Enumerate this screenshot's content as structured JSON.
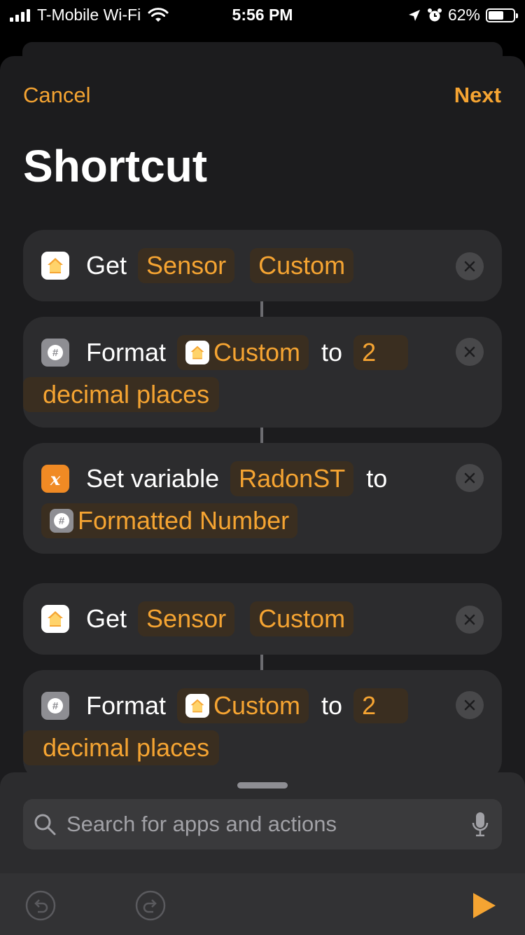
{
  "status_bar": {
    "carrier": "T-Mobile Wi-Fi",
    "time": "5:56 PM",
    "battery_percent": "62%",
    "battery_level": 0.62,
    "icons": [
      "signal-bars-icon",
      "wifi-icon",
      "location-arrow-icon",
      "alarm-icon",
      "battery-icon"
    ]
  },
  "nav": {
    "cancel_label": "Cancel",
    "next_label": "Next",
    "title": "Shortcut"
  },
  "actions": [
    {
      "type": "get",
      "icon": "home-icon",
      "verb": "Get",
      "param1": "Sensor",
      "param2": "Custom"
    },
    {
      "type": "format",
      "icon": "number-icon",
      "verb": "Format",
      "input": "Custom",
      "connector": "to",
      "places": "2",
      "unit": "decimal places"
    },
    {
      "type": "set-variable",
      "icon": "variable-icon",
      "verb": "Set variable",
      "var_name": "RadonST",
      "connector": "to",
      "value": "Formatted Number",
      "var_glyph": "x"
    },
    {
      "type": "get",
      "icon": "home-icon",
      "verb": "Get",
      "param1": "Sensor",
      "param2": "Custom"
    },
    {
      "type": "format",
      "icon": "number-icon",
      "verb": "Format",
      "input": "Custom",
      "connector": "to",
      "places": "2",
      "unit": "decimal places"
    }
  ],
  "search": {
    "placeholder": "Search for apps and actions"
  },
  "toolbar": {
    "icons": [
      "undo-icon",
      "redo-icon",
      "play-icon"
    ]
  },
  "colors": {
    "accent": "#f5a432",
    "sheet_bg": "#1c1c1e",
    "card_bg": "#2c2c2e",
    "token_bg": "#3a2e20",
    "variable_orange": "#f08a24"
  }
}
